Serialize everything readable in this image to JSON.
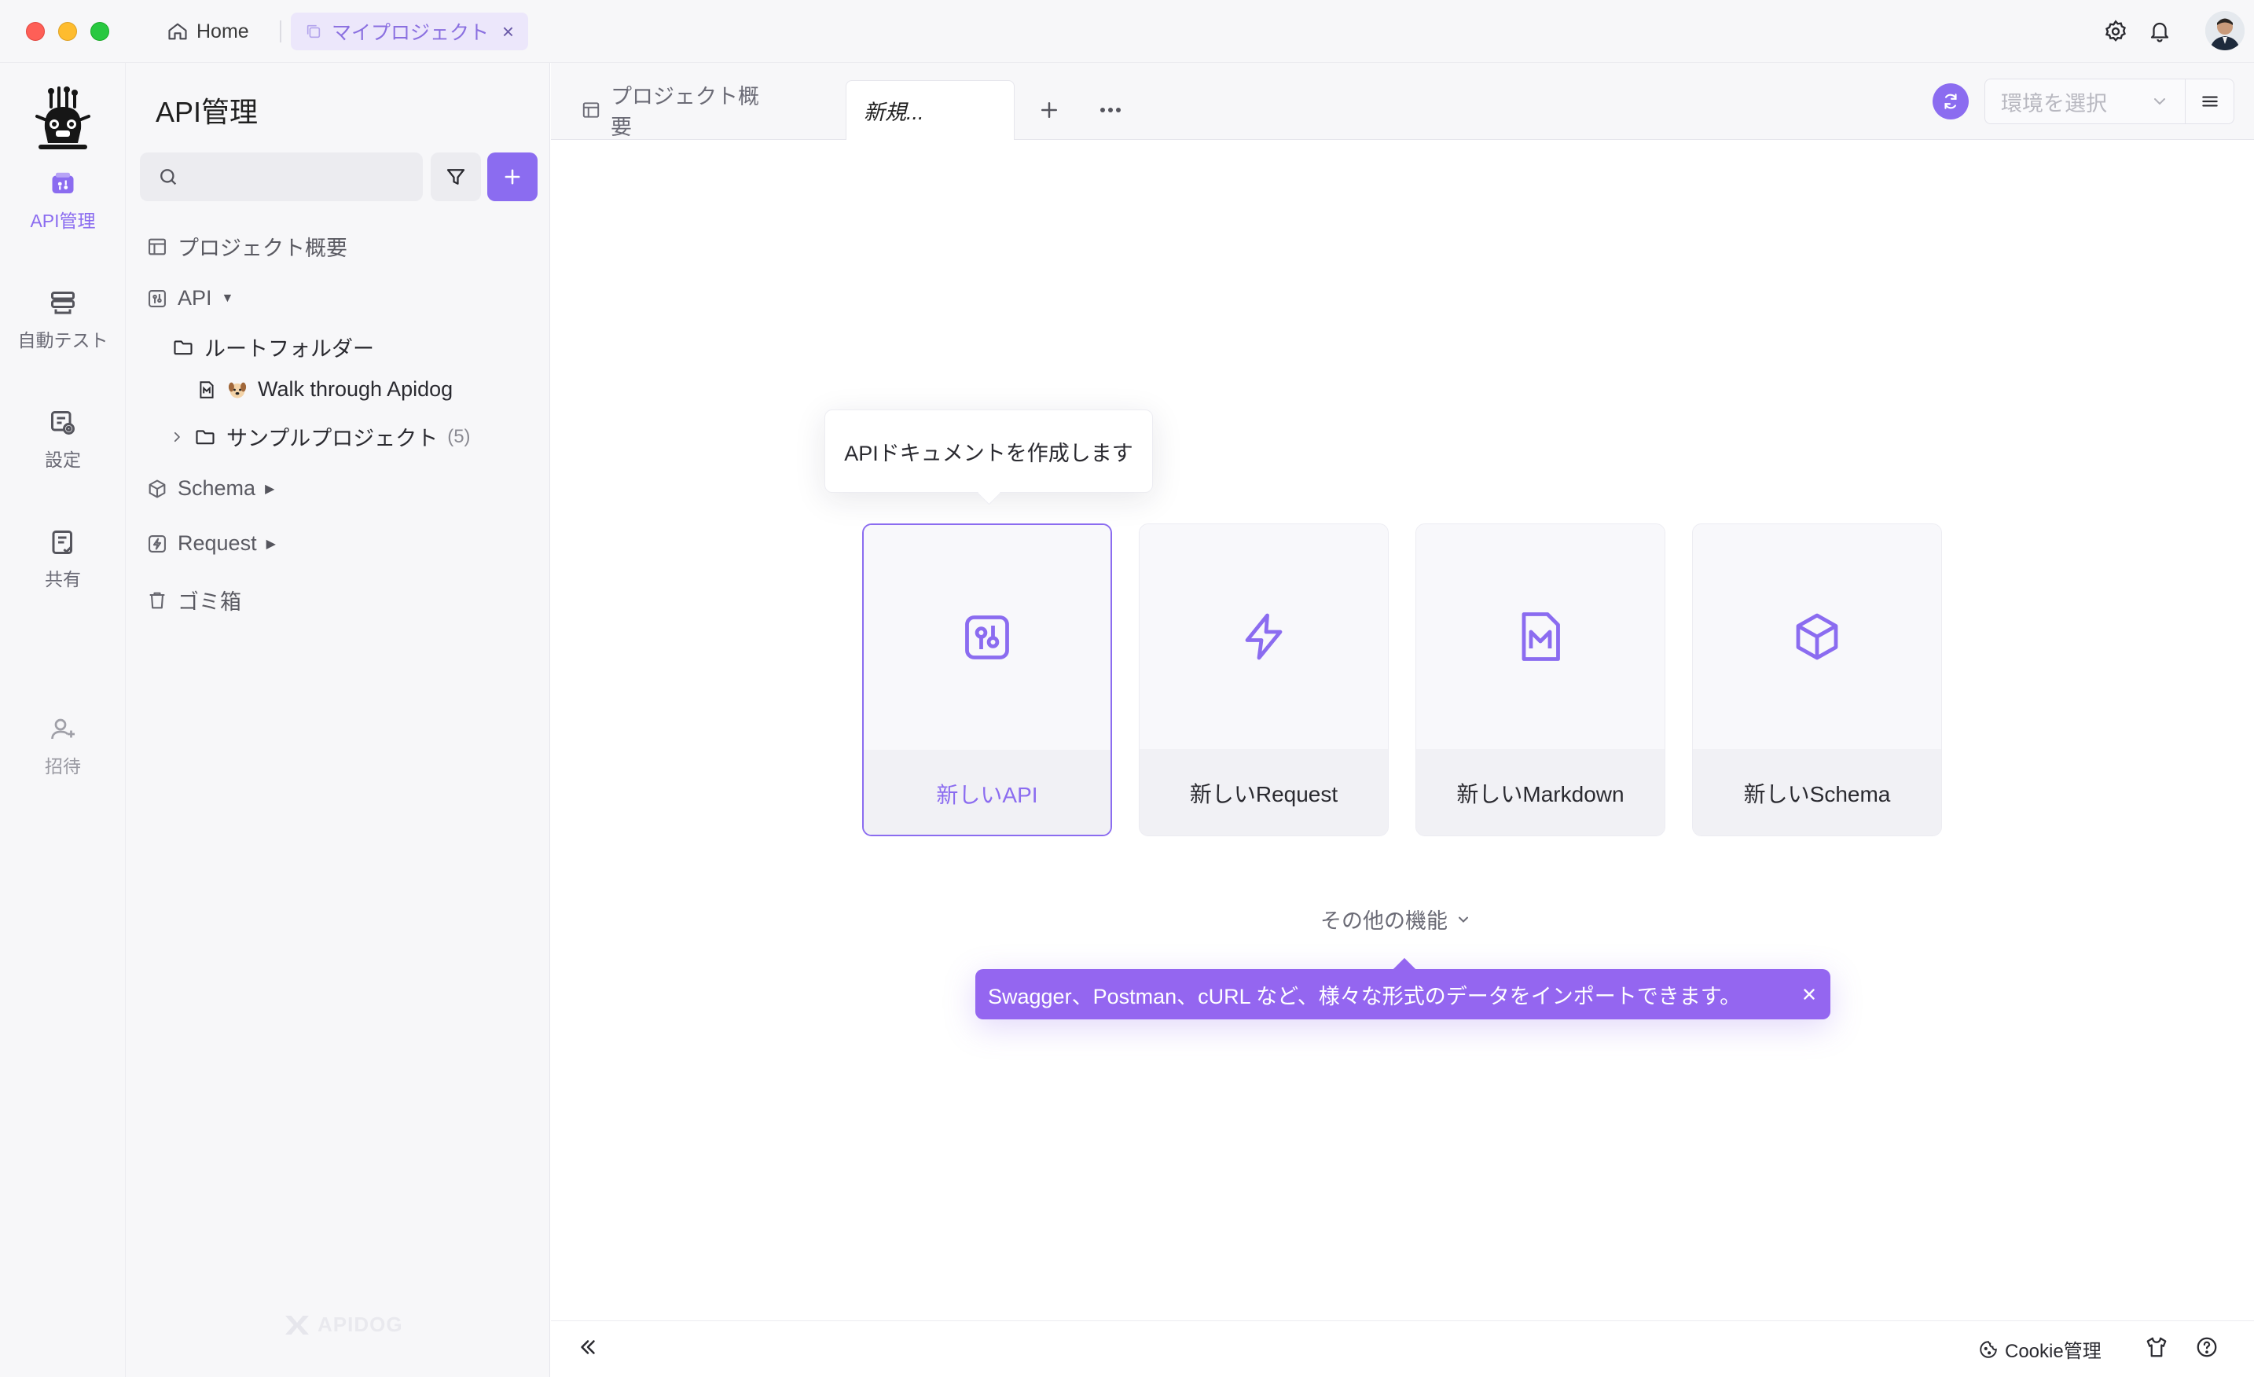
{
  "titlebar": {
    "home_label": "Home",
    "project_tab_label": "マイプロジェクト",
    "project_tab_close": "×"
  },
  "rail": {
    "items": [
      {
        "label": "API管理",
        "icon": "api-doc-icon",
        "active": true
      },
      {
        "label": "自動テスト",
        "icon": "auto-test-icon",
        "active": false
      },
      {
        "label": "設定",
        "icon": "settings-icon",
        "active": false
      },
      {
        "label": "共有",
        "icon": "share-icon",
        "active": false
      },
      {
        "label": "招待",
        "icon": "invite-icon",
        "active": false
      }
    ]
  },
  "sidebar": {
    "title": "API管理",
    "search_placeholder": "",
    "tree": {
      "overview": "プロジェクト概要",
      "api": "API",
      "root_folder": "ルートフォルダー",
      "walk_through": "Walk through Apidog",
      "sample_project": "サンプルプロジェクト",
      "sample_count": "(5)",
      "schema": "Schema",
      "request": "Request",
      "trash": "ゴミ箱"
    },
    "watermark": "APIDOG"
  },
  "tabbar": {
    "tabs": [
      {
        "label": "プロジェクト概要",
        "active": false
      },
      {
        "label": "新規...",
        "active": true
      }
    ],
    "env_placeholder": "環境を選択"
  },
  "main": {
    "tooltip": "APIドキュメントを作成します",
    "cards": [
      {
        "label": "新しいAPI",
        "icon": "api-doc-icon",
        "selected": true
      },
      {
        "label": "新しいRequest",
        "icon": "lightning-icon",
        "selected": false
      },
      {
        "label": "新しいMarkdown",
        "icon": "markdown-icon",
        "selected": false
      },
      {
        "label": "新しいSchema",
        "icon": "cube-icon",
        "selected": false
      }
    ],
    "more_features": "その他の機能",
    "banner": "Swagger、Postman、cURL など、様々な形式のデータをインポートできます。"
  },
  "statusbar": {
    "cookie_label": "Cookie管理"
  },
  "colors": {
    "accent": "#8b6cf0",
    "banner": "#9466f0",
    "rail_bg": "#f7f7f9"
  }
}
